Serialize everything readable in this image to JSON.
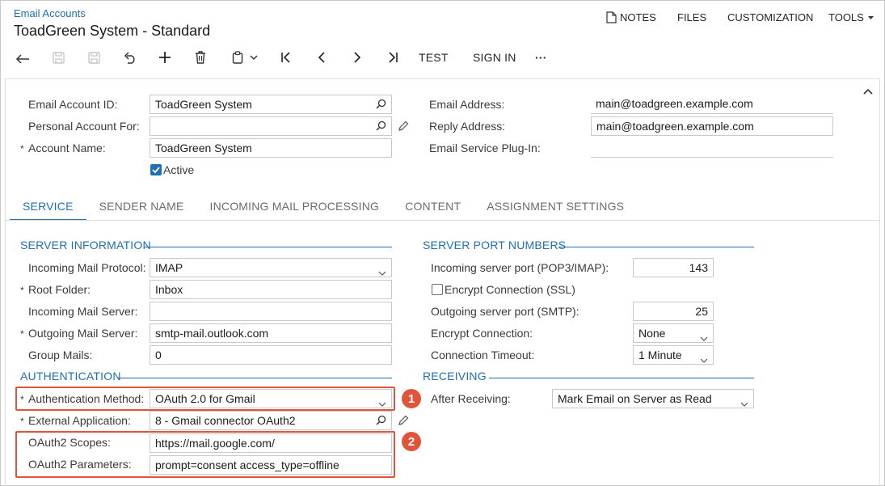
{
  "header": {
    "breadcrumb": "Email Accounts",
    "title": "ToadGreen System - Standard",
    "menu": {
      "notes": "NOTES",
      "files": "FILES",
      "customization": "CUSTOMIZATION",
      "tools": "TOOLS"
    }
  },
  "toolbar": {
    "icons": [
      "back-icon",
      "save-close-icon",
      "save-icon",
      "undo-icon",
      "add-icon",
      "delete-icon",
      "copy-paste-icon",
      "first-record-icon",
      "previous-record-icon",
      "next-record-icon",
      "last-record-icon",
      "more-icon"
    ],
    "test": "TEST",
    "sign_in": "SIGN IN",
    "more": "···"
  },
  "form": {
    "email_account_id": {
      "label": "Email Account ID:",
      "value": "ToadGreen System"
    },
    "personal_account_for": {
      "label": "Personal Account For:",
      "value": ""
    },
    "account_name": {
      "label": "Account Name:",
      "value": "ToadGreen System"
    },
    "active": {
      "label": "Active",
      "checked": true
    },
    "email_address": {
      "label": "Email Address:",
      "value": "main@toadgreen.example.com"
    },
    "reply_address": {
      "label": "Reply Address:",
      "value": "main@toadgreen.example.com"
    },
    "email_service_plugin": {
      "label": "Email Service Plug-In:",
      "value": ""
    }
  },
  "tabs": [
    "SERVICE",
    "SENDER NAME",
    "INCOMING MAIL PROCESSING",
    "CONTENT",
    "ASSIGNMENT SETTINGS"
  ],
  "active_tab": "SERVICE",
  "server_information": {
    "title": "SERVER INFORMATION",
    "incoming_mail_protocol": {
      "label": "Incoming Mail Protocol:",
      "value": "IMAP"
    },
    "root_folder": {
      "label": "Root Folder:",
      "value": "Inbox"
    },
    "incoming_mail_server": {
      "label": "Incoming Mail Server:",
      "value": ""
    },
    "outgoing_mail_server": {
      "label": "Outgoing Mail Server:",
      "value": "smtp-mail.outlook.com"
    },
    "group_mails": {
      "label": "Group Mails:",
      "value": "0"
    }
  },
  "authentication": {
    "title": "AUTHENTICATION",
    "method": {
      "label": "Authentication Method:",
      "value": "OAuth 2.0 for Gmail"
    },
    "external_application": {
      "label": "External Application:",
      "value": "8 - Gmail connector OAuth2"
    },
    "scopes": {
      "label": "OAuth2 Scopes:",
      "value": "https://mail.google.com/"
    },
    "parameters": {
      "label": "OAuth2 Parameters:",
      "value": "prompt=consent access_type=offline"
    }
  },
  "server_port_numbers": {
    "title": "SERVER PORT NUMBERS",
    "incoming_port": {
      "label": "Incoming server port (POP3/IMAP):",
      "value": "143"
    },
    "encrypt_ssl": {
      "label": "Encrypt Connection (SSL)",
      "checked": false
    },
    "outgoing_port": {
      "label": "Outgoing server port (SMTP):",
      "value": "25"
    },
    "encrypt_connection": {
      "label": "Encrypt Connection:",
      "value": "None"
    },
    "connection_timeout": {
      "label": "Connection Timeout:",
      "value": "1 Minute"
    }
  },
  "receiving": {
    "title": "RECEIVING",
    "after_receiving": {
      "label": "After Receiving:",
      "value": "Mark Email on Server as Read"
    }
  },
  "callouts": [
    "1",
    "2"
  ],
  "colors": {
    "accent": "#1f6fb2",
    "highlight": "#e0553a",
    "border": "#c9c9c9"
  }
}
